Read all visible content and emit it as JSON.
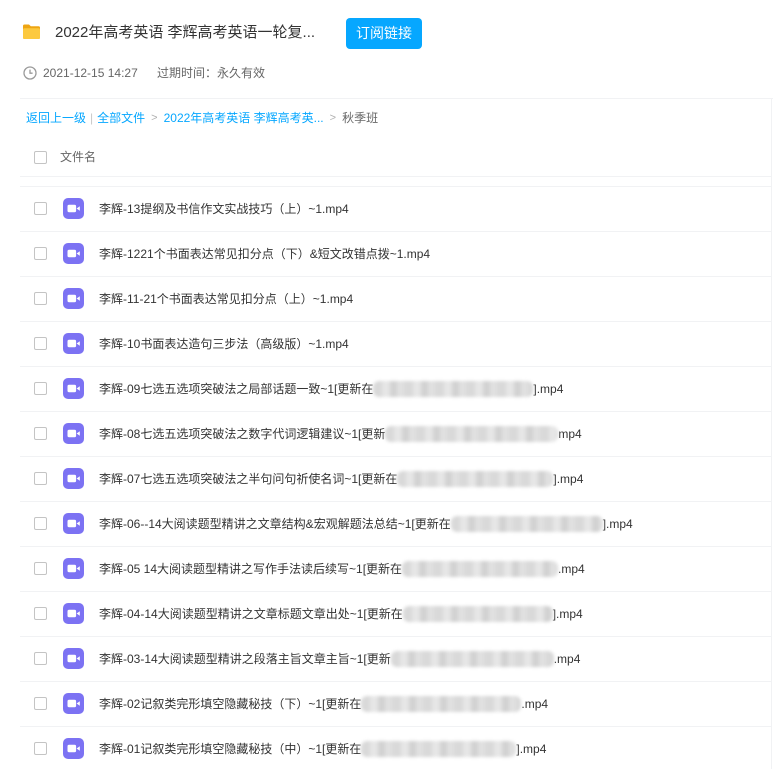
{
  "header": {
    "title": "2022年高考英语 李辉高考英语一轮复...",
    "subscribe_label": "订阅链接",
    "share_time": "2021-12-15 14:27",
    "expire": "过期时间：永久有效"
  },
  "breadcrumb": {
    "back": "返回上一级",
    "divider": "|",
    "all_files": "全部文件",
    "sep": ">",
    "parent": "2022年高考英语 李辉高考英...",
    "current": "秋季班"
  },
  "list": {
    "column_name": "文件名",
    "files": [
      {
        "name": "李辉-13提纲及书信作文实战技巧（上）~1.mp4"
      },
      {
        "name": "李辉-1221个书面表达常见扣分点（下）&短文改错点拨~1.mp4"
      },
      {
        "name": "李辉-11-21个书面表达常见扣分点（上）~1.mp4"
      },
      {
        "name": "李辉-10书面表达造句三步法（高级版）~1.mp4"
      },
      {
        "name": "李辉-09七选五选项突破法之局部话题一致~1[更新在",
        "redacted": true,
        "suffix": "].mp4"
      },
      {
        "name": "李辉-08七选五选项突破法之数字代词逻辑建议~1[更新",
        "redacted": true,
        "suffix": "mp4"
      },
      {
        "name": "李辉-07七选五选项突破法之半句问句祈使名词~1[更新在",
        "redacted": true,
        "suffix": "].mp4"
      },
      {
        "name": "李辉-06--14大阅读题型精讲之文章结构&宏观解题法总结~1[更新在",
        "redacted": true,
        "suffix": "].mp4"
      },
      {
        "name": "李辉-05 14大阅读题型精讲之写作手法读后续写~1[更新在",
        "redacted": true,
        "suffix": ".mp4"
      },
      {
        "name": "李辉-04-14大阅读题型精讲之文章标题文章出处~1[更新在",
        "redacted": true,
        "suffix": "].mp4"
      },
      {
        "name": "李辉-03-14大阅读题型精讲之段落主旨文章主旨~1[更新",
        "redacted": true,
        "suffix": ".mp4"
      },
      {
        "name": "李辉-02记叙类完形填空隐藏秘技（下）~1[更新在",
        "redacted": true,
        "suffix": ".mp4"
      },
      {
        "name": "李辉-01记叙类完形填空隐藏秘技（中）~1[更新在",
        "redacted": true,
        "suffix": "].mp4"
      }
    ]
  },
  "colors": {
    "accent": "#06a7ff",
    "video_icon": "#7c72f3",
    "folder": "#fcc93f",
    "text": "#333333",
    "muted": "#666666"
  },
  "icons": {
    "folder": "folder-icon",
    "clock": "clock-icon",
    "file": "video-file-icon",
    "checkbox": "checkbox"
  }
}
